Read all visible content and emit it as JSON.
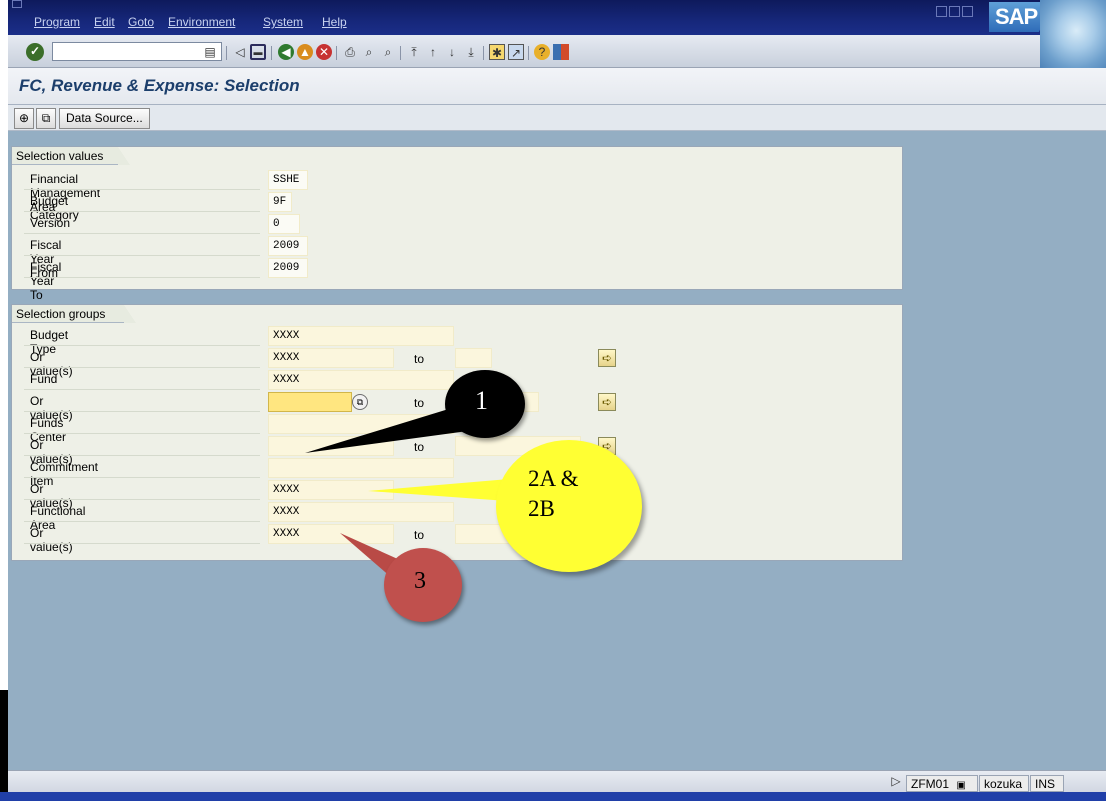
{
  "menubar": {
    "items": [
      "Program",
      "Edit",
      "Goto",
      "Environment",
      "System",
      "Help"
    ],
    "logo": "SAP"
  },
  "toolbar": {
    "command_field": "",
    "icons": [
      "enter-icon",
      "save-icon",
      "back-icon",
      "exit-icon",
      "cancel-icon",
      "print-icon",
      "find-icon",
      "find-next-icon",
      "first-page-icon",
      "previous-page-icon",
      "next-page-icon",
      "last-page-icon",
      "create-session-icon",
      "shortcut-icon",
      "help-icon",
      "customize-layout-icon"
    ]
  },
  "page": {
    "title": "FC, Revenue & Expense: Selection"
  },
  "app_toolbar": {
    "data_source_label": "Data Source..."
  },
  "selection_values": {
    "title": "Selection values",
    "rows": [
      {
        "label": "Financial Management Area",
        "value": "SSHE"
      },
      {
        "label": "Budget Category",
        "value": "9F"
      },
      {
        "label": "Version",
        "value": "0"
      },
      {
        "label": "Fiscal Year From",
        "value": "2009"
      },
      {
        "label": "Fiscal Year To",
        "value": "2009"
      }
    ]
  },
  "selection_groups": {
    "title": "Selection groups",
    "to_label": "to",
    "rows": [
      {
        "label": "Budget Type",
        "value": "XXXX"
      },
      {
        "label": "Or value(s)",
        "value": "XXXX"
      },
      {
        "label": "Fund",
        "value": "XXXX"
      },
      {
        "label": "Or value(s)",
        "value": ""
      },
      {
        "label": "Funds Center",
        "value": ""
      },
      {
        "label": "Or value(s)",
        "value": ""
      },
      {
        "label": "Commitment Item",
        "value": ""
      },
      {
        "label": "Or value(s)",
        "value": "XXXX"
      },
      {
        "label": "Functional Area",
        "value": "XXXX"
      },
      {
        "label": "Or value(s)",
        "value": "XXXX"
      }
    ]
  },
  "callouts": {
    "c1": "1",
    "c2a": "2A &",
    "c2b": "2B",
    "c3": "3",
    "colors": {
      "c1": "#000000",
      "c2": "#ffff33",
      "c3": "#c0504d"
    }
  },
  "status_bar": {
    "transaction": "ZFM01",
    "user": "kozuka",
    "mode": "INS"
  }
}
